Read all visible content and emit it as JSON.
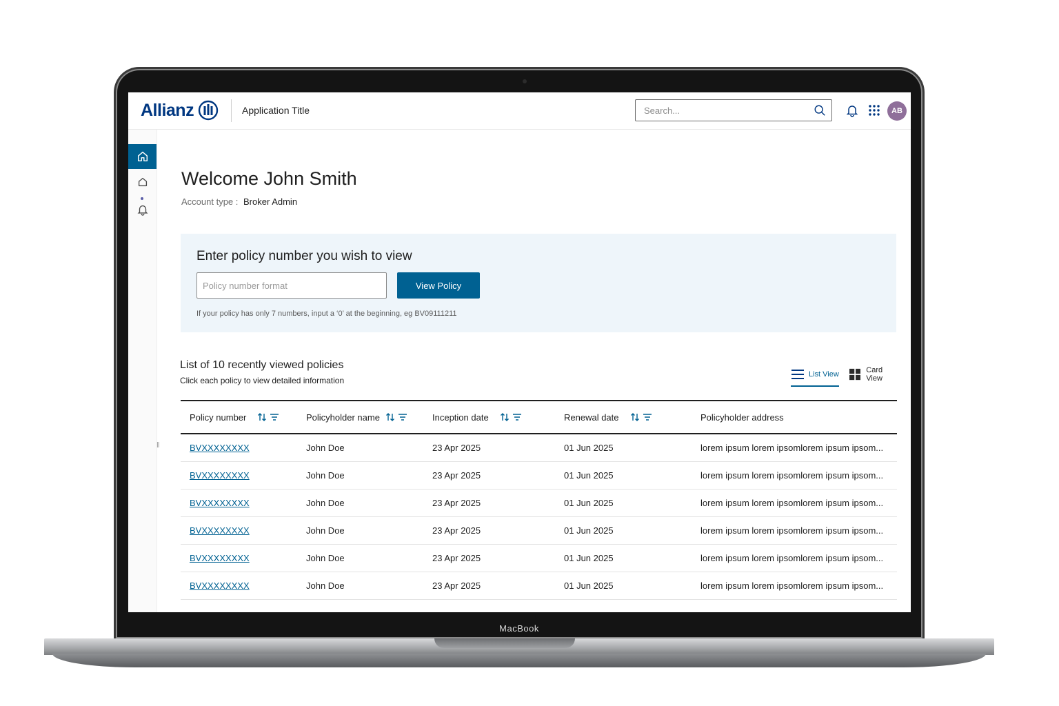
{
  "device": {
    "label": "MacBook"
  },
  "header": {
    "logo_text": "Allianz",
    "app_title": "Application Title",
    "search_placeholder": "Search...",
    "avatar_initials": "AB"
  },
  "welcome": {
    "title": "Welcome John Smith",
    "account_type_label": "Account type :",
    "account_type_value": "Broker Admin"
  },
  "policy_lookup": {
    "heading": "Enter policy number you wish to view",
    "input_placeholder": "Policy number format",
    "button_label": "View Policy",
    "hint": "If your policy has only 7 numbers, input a ‘0’ at the beginning, eg BV09111211"
  },
  "recent": {
    "title": "List of 10 recently viewed policies",
    "subtitle": "Click each policy to view detailed information",
    "list_view_label": "List View",
    "card_view_label": "Card View"
  },
  "table": {
    "columns": [
      "Policy number",
      "Policyholder name",
      "Inception date",
      "Renewal date",
      "Policyholder address"
    ],
    "rows": [
      [
        "BVXXXXXXXX",
        "John Doe",
        "23 Apr 2025",
        "01 Jun 2025",
        "lorem ipsum lorem ipsomlorem ipsum ipsom..."
      ],
      [
        "BVXXXXXXXX",
        "John Doe",
        "23 Apr 2025",
        "01 Jun 2025",
        "lorem ipsum lorem ipsomlorem ipsum ipsom..."
      ],
      [
        "BVXXXXXXXX",
        "John Doe",
        "23 Apr 2025",
        "01 Jun 2025",
        "lorem ipsum lorem ipsomlorem ipsum ipsom..."
      ],
      [
        "BVXXXXXXXX",
        "John Doe",
        "23 Apr 2025",
        "01 Jun 2025",
        "lorem ipsum lorem ipsomlorem ipsum ipsom..."
      ],
      [
        "BVXXXXXXXX",
        "John Doe",
        "23 Apr 2025",
        "01 Jun 2025",
        "lorem ipsum lorem ipsomlorem ipsum ipsom..."
      ],
      [
        "BVXXXXXXXX",
        "John Doe",
        "23 Apr 2025",
        "01 Jun 2025",
        "lorem ipsum lorem ipsomlorem ipsum ipsom..."
      ]
    ]
  },
  "colors": {
    "brand": "#003781",
    "accent": "#006192",
    "panel": "#eef5fa"
  }
}
